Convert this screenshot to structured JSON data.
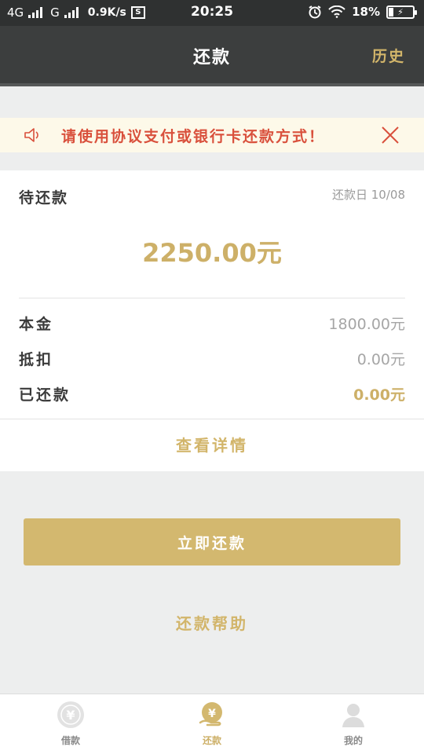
{
  "status_bar": {
    "network1": "4G",
    "network2": "G",
    "speed": "0.9K/s",
    "sim_icon_label": "S",
    "time": "20:25",
    "battery": "18%",
    "icons": [
      "signal-icon",
      "screenshot-icon",
      "alarm-icon",
      "wifi-icon",
      "battery-icon"
    ]
  },
  "nav": {
    "title": "还款",
    "history_label": "历史"
  },
  "notice": {
    "text": "请使用协议支付或银行卡还款方式！",
    "icons": [
      "speaker-icon",
      "close-icon"
    ]
  },
  "repayment": {
    "due_label": "待还款",
    "due_date": "还款日 10/08",
    "amount": "2250.00元",
    "rows": [
      {
        "key": "本金",
        "value": "1800.00元"
      },
      {
        "key": "抵扣",
        "value": "0.00元"
      },
      {
        "key": "已还款",
        "value": "0.00元"
      }
    ],
    "detail_link": "查看详情"
  },
  "actions": {
    "repay_now": "立即还款",
    "help": "还款帮助"
  },
  "tabbar": {
    "tabs": [
      {
        "label": "借款",
        "icon": "yen-coin-icon"
      },
      {
        "label": "还款",
        "icon": "yen-hand-icon"
      },
      {
        "label": "我的",
        "icon": "user-icon"
      }
    ],
    "active_index": 1
  },
  "colors": {
    "accent_gold": "#d3b86f",
    "nav_bg": "#3c3e3e",
    "notice_text": "#d9503c",
    "notice_bg": "#fdf9e9"
  }
}
